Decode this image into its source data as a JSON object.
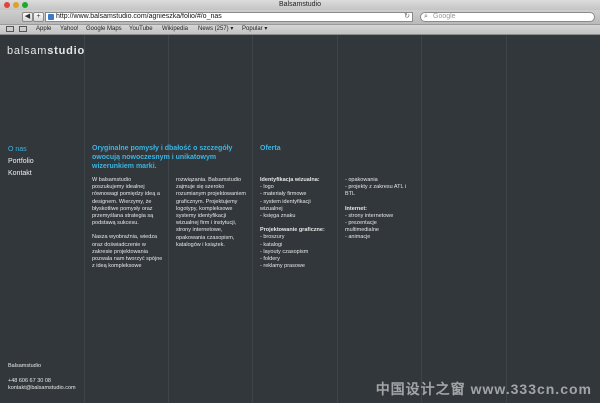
{
  "window": {
    "title": "Balsamstudio"
  },
  "toolbar": {
    "back_label": "◀",
    "add_label": "+",
    "url": "http://www.balsamstudio.com/agnieszka/folio/#/o_nas",
    "search_placeholder": "Google"
  },
  "bookmarks": {
    "items": [
      "Apple",
      "Yahoo!",
      "Google Maps",
      "YouTube",
      "Wikipedia",
      "News (257)",
      "Popular"
    ]
  },
  "site": {
    "logo_light": "balsam",
    "logo_bold": "studio",
    "nav": [
      "O nas",
      "Portfolio",
      "Kontakt"
    ],
    "intro_heading": "Oryginalne pomysły i dbałość o szczegóły owocują nowoczesnym i unikatowym wizerunkiem marki.",
    "col1_p1": "W balsamstudio poszukujemy idealnej równowagi pomiędzy ideą a designem. Wierzymy, że błyskotliwe pomysły oraz przemyślana strategia są podstawą sukcesu.",
    "col1_p2": "Nasza wyobraźnia, wiedza oraz doświadczenie w zakresie projektowania pozwala nam tworzyć spójne z ideą kompleksowe",
    "col2_p1": "rozwiązania. Balsamstudio zajmuje się szeroko rozumianym projektowaniem graficznym. Projektujemy logotypy, kompleksowe systemy identyfikacji wizualnej firm i instytucji, strony internetowe, opakowania czasopism, katalogów i książek.",
    "offer_heading": "Oferta",
    "offer": {
      "ident_title": "Identyfikacja wizualna:",
      "ident_items": [
        "- logo",
        "- materiały firmowe",
        "- system identyfikacji",
        "wizualnej",
        "- księga znaku"
      ],
      "graphic_title": "Projektowanie graficzne:",
      "graphic_items": [
        "- broszury",
        "- katalogi",
        "- layouty czasopism",
        "- foldery",
        "- reklamy prasowe"
      ],
      "more_items": [
        "- opakowania",
        "- projekty z zakresu ATL i",
        "BTL"
      ],
      "internet_title": "Internet:",
      "internet_items": [
        "- strony internetowe",
        "- prezentacje",
        "multimedialne",
        "- animacje"
      ]
    },
    "footer": {
      "company": "Balsamstudio",
      "phone": "+48 606 67 30 08",
      "email": "kontakt@balsamstudio.com"
    },
    "watermark": "中国设计之窗 www.333cn.com"
  },
  "colors": {
    "accent": "#3bb6e4",
    "background": "#31373a",
    "text": "#e8e8e8"
  }
}
